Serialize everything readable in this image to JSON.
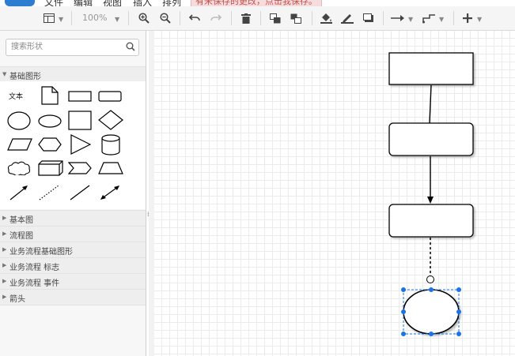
{
  "menu": {
    "items": [
      "文件",
      "编辑",
      "视图",
      "插入",
      "排列"
    ],
    "notice": "有未保存的更改，点击我保存。"
  },
  "toolbar": {
    "zoom": "100%",
    "icons": [
      "page-view-icon",
      "zoom-in-icon",
      "zoom-out-icon",
      "undo-icon",
      "redo-icon",
      "delete-icon",
      "to-front-icon",
      "to-back-icon",
      "fill-color-icon",
      "line-color-icon",
      "shadow-icon",
      "connection-icon",
      "waypoints-icon",
      "insert-icon"
    ]
  },
  "sidebar": {
    "search_placeholder": "搜索形状",
    "open_section": "基础图形",
    "text_shape_label": "文本",
    "sections": [
      "基本图",
      "流程图",
      "业务流程基础图形",
      "业务流程 标志",
      "业务流程 事件",
      "箭头"
    ]
  },
  "colors": {
    "accent": "#2f7dd1",
    "selection": "#1a73e8",
    "notice_bg": "#f6dcdc",
    "notice_text": "#c0504d"
  }
}
